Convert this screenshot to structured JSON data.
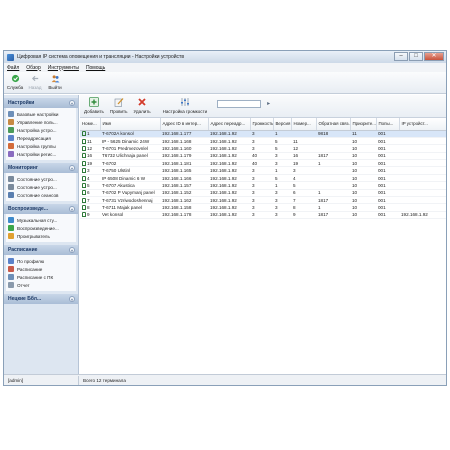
{
  "window": {
    "title": "Цифровая IP система оповещения и трансляции  -  Настройки устройств"
  },
  "menu": [
    "Файл",
    "Обзор",
    "Инструменты",
    "Помощь"
  ],
  "toolbar": {
    "service": "Служба",
    "back": "Назад",
    "exit": "Выйти"
  },
  "sidebar": {
    "sections": [
      {
        "title": "Настройки",
        "items": [
          "Базовые настройки",
          "Управление поль...",
          "Настройка устро...",
          "Переадресация",
          "Настройка группы",
          "Настройки регис..."
        ]
      },
      {
        "title": "Мониторинг",
        "items": [
          "Состояние устро...",
          "Состояние устро...",
          "Состояние сеансов"
        ]
      },
      {
        "title": "Воспроизведе...",
        "items": [
          "Музыкальная сту...",
          "Воспроизведение...",
          "Проигрыватель"
        ]
      },
      {
        "title": "Расписание",
        "items": [
          "По профилю",
          "Расписание",
          "Расписание с ПК",
          "Отчет"
        ]
      },
      {
        "title": "Нецкие Ббл...",
        "items": []
      }
    ]
  },
  "content_toolbar": {
    "add": "Добавить",
    "check": "Провить",
    "delete": "Удалить",
    "volume": "Настройка громкости"
  },
  "table": {
    "columns": [
      "Номе...",
      "Имя",
      "Адрес ID в интер...",
      "Адрес переадр...",
      "Громкость",
      "Версия",
      "Номер...",
      "Обратная связ...",
      "Приорите...",
      "Попы...",
      "IP устройст..."
    ],
    "rows": [
      [
        "1",
        "T-6702A konsol",
        "192.168.1.177",
        "192.168.1.92",
        "3",
        "1",
        "",
        "9818",
        "11",
        "001",
        ""
      ],
      [
        "11",
        "IP - 5625 Dinamic 24W",
        "192.168.1.168",
        "192.168.1.92",
        "3",
        "5",
        "11",
        "",
        "10",
        "001",
        ""
      ],
      [
        "12",
        "T-6701 Predmezovnlel",
        "192.168.1.160",
        "192.168.1.92",
        "3",
        "5",
        "12",
        "",
        "10",
        "001",
        ""
      ],
      [
        "16",
        "T6732 Ulichnaja panel",
        "192.168.1.179",
        "192.168.1.92",
        "40",
        "3",
        "16",
        "1817",
        "10",
        "001",
        ""
      ],
      [
        "19",
        "T-6702",
        "192.168.1.181",
        "192.168.1.92",
        "40",
        "3",
        "19",
        "1",
        "10",
        "001",
        ""
      ],
      [
        "3",
        "T-6750 Ulstinl",
        "192.168.1.165",
        "192.168.1.92",
        "3",
        "1",
        "3",
        "",
        "10",
        "001",
        ""
      ],
      [
        "4",
        "IP 6508 Dinamic 6 W",
        "192.168.1.166",
        "192.168.1.92",
        "3",
        "5",
        "4",
        "",
        "10",
        "001",
        ""
      ],
      [
        "5",
        "T-6707 Akustica",
        "192.168.1.157",
        "192.168.1.92",
        "3",
        "1",
        "5",
        "",
        "10",
        "001",
        ""
      ],
      [
        "6",
        "T-6702 P Vupymanj panel",
        "192.168.1.152",
        "192.168.1.92",
        "3",
        "3",
        "6",
        "1",
        "10",
        "001",
        ""
      ],
      [
        "7",
        "T-6731 Vzriwodoshennaj",
        "192.168.1.162",
        "192.168.1.92",
        "3",
        "3",
        "7",
        "1817",
        "10",
        "001",
        ""
      ],
      [
        "8",
        "T-6711 Majak panel",
        "192.168.1.158",
        "192.168.1.92",
        "3",
        "3",
        "8",
        "1",
        "10",
        "001",
        ""
      ],
      [
        "9",
        "Vet konsol",
        "192.168.1.178",
        "192.168.1.92",
        "3",
        "3",
        "9",
        "1817",
        "10",
        "001",
        "192.168.1.92"
      ]
    ]
  },
  "status": {
    "user": "[admin]",
    "count": "Всего 12 терминала"
  }
}
